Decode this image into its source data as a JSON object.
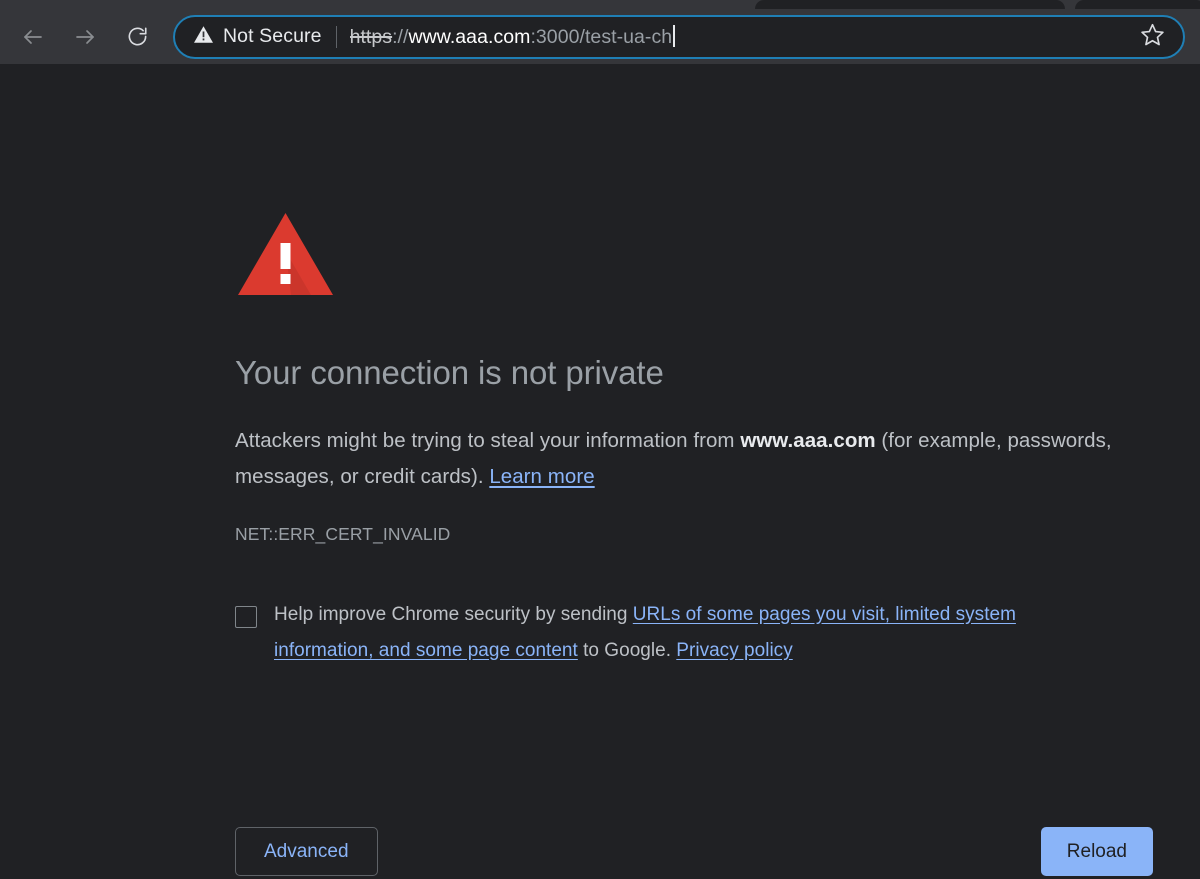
{
  "browser": {
    "nav": {
      "back_label": "Back",
      "forward_label": "Forward",
      "reload_label": "Reload this page"
    },
    "omnibox": {
      "security_state": "Not Secure",
      "url_scheme": "https",
      "url_separator": "://",
      "url_host": "www.aaa.com",
      "url_rest": ":3000/test-ua-ch",
      "full_url": "https://www.aaa.com:3000/test-ua-ch",
      "bookmark_label": "Bookmark this tab"
    }
  },
  "interstitial": {
    "title": "Your connection is not private",
    "body_part1": "Attackers might be trying to steal your information from ",
    "body_host": "www.aaa.com",
    "body_part2": " (for example, passwords, messages, or credit cards). ",
    "learn_more": "Learn more",
    "error_code": "NET::ERR_CERT_INVALID",
    "optin_part1": "Help improve Chrome security by sending ",
    "optin_link1": "URLs of some pages you visit, limited system information, and some page content",
    "optin_part2": " to Google. ",
    "optin_link2": "Privacy policy",
    "advanced_label": "Advanced",
    "reload_label": "Reload"
  },
  "colors": {
    "page_bg": "#202124",
    "toolbar_bg": "#35363a",
    "warning_red": "#db3a2f",
    "link_blue": "#8ab4f8",
    "focus_ring": "#1f7fb5",
    "heading_gray": "#9aa0a6",
    "body_gray": "#bdc1c6"
  }
}
